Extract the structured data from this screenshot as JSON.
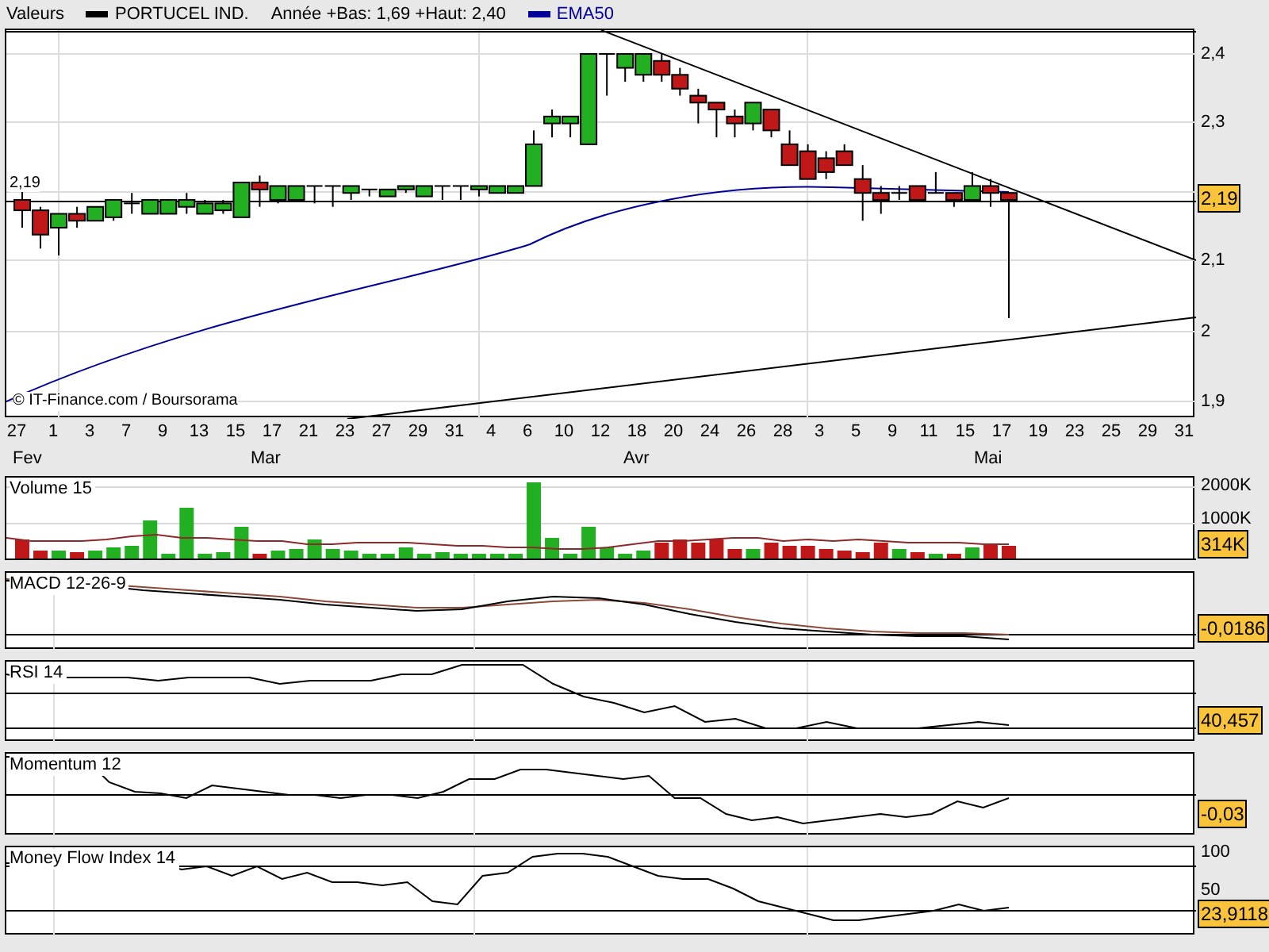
{
  "legend": {
    "items": [
      {
        "kind": "label",
        "label": "Valeurs"
      },
      {
        "kind": "series",
        "label": "PORTUCEL IND.",
        "color": "#000000"
      },
      {
        "kind": "label",
        "label": "Année +Bas: 1,69 +Haut: 2,40"
      },
      {
        "kind": "series",
        "label": "EMA50",
        "color": "#000099"
      }
    ]
  },
  "price_panel": {
    "left_marker": "2,19",
    "credit": "© IT-Finance.com / Boursorama",
    "yticks": [
      "2,4",
      "2,3",
      "2,1",
      "2",
      "1,9"
    ],
    "last_value": "2,19"
  },
  "x_axis": {
    "days": [
      "27",
      "1",
      "3",
      "7",
      "9",
      "13",
      "15",
      "17",
      "21",
      "23",
      "27",
      "29",
      "31",
      "4",
      "6",
      "10",
      "12",
      "18",
      "20",
      "24",
      "26",
      "28",
      "3",
      "5",
      "9",
      "11",
      "15",
      "17",
      "19",
      "23",
      "25",
      "29",
      "31"
    ],
    "months": [
      "Fev",
      "Mar",
      "Avr",
      "Mai"
    ]
  },
  "indicators": [
    {
      "kind": "volume",
      "title": "Volume 15",
      "yticks": [
        "2000K",
        "1000K"
      ],
      "last_value": "314K"
    },
    {
      "kind": "macd",
      "title": "MACD 12-26-9",
      "last_value": "-0,0186"
    },
    {
      "kind": "rsi",
      "title": "RSI 14",
      "last_value": "40,457"
    },
    {
      "kind": "momentum",
      "title": "Momentum 12",
      "last_value": "-0,03"
    },
    {
      "kind": "mfi",
      "title": "Money Flow Index 14",
      "yticks": [
        "100",
        "50"
      ],
      "last_value": "23,9118"
    }
  ]
}
